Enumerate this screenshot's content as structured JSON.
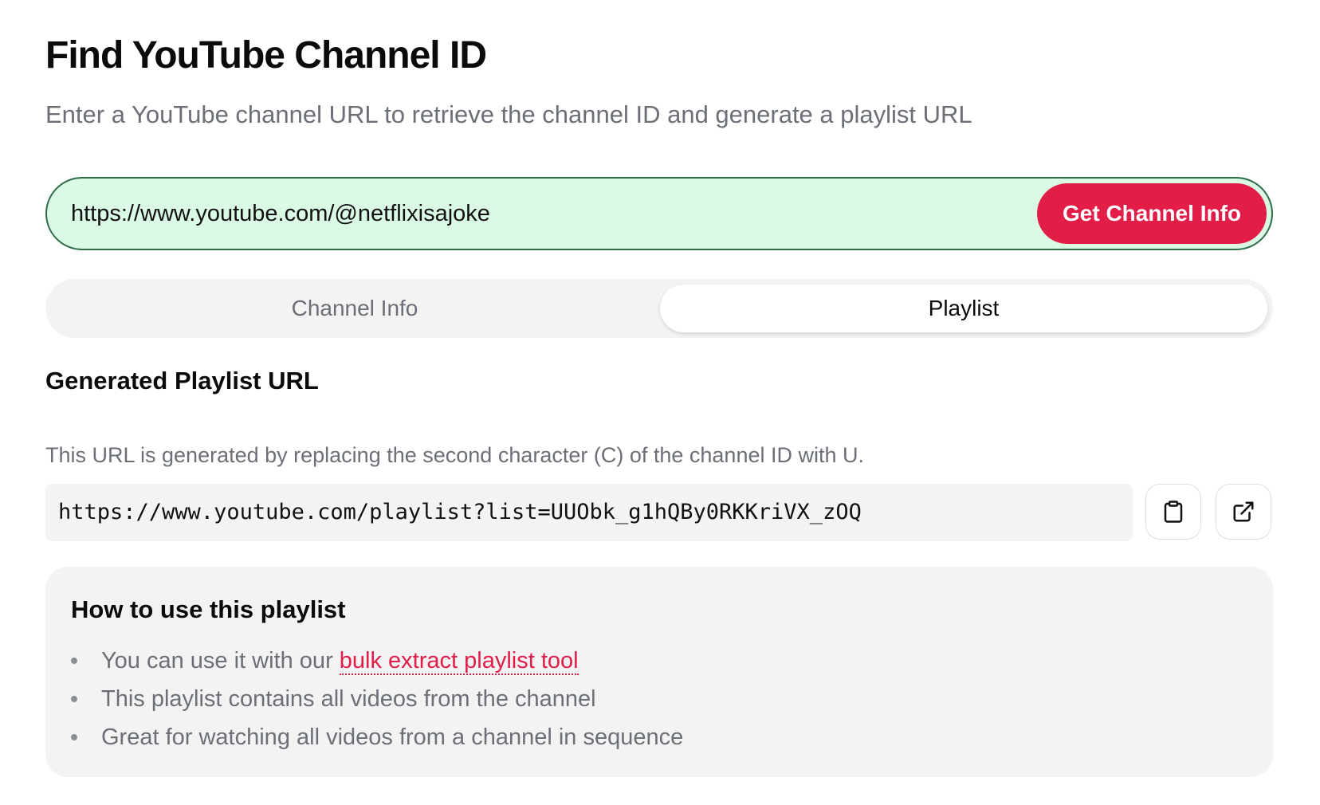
{
  "header": {
    "title": "Find YouTube Channel ID",
    "subtitle": "Enter a YouTube channel URL to retrieve the channel ID and generate a playlist URL"
  },
  "search": {
    "value": "https://www.youtube.com/@netflixisajoke",
    "button_label": "Get Channel Info",
    "button_color": "#e11d48",
    "input_background": "#dbfae6"
  },
  "tabs": [
    {
      "label": "Channel Info",
      "active": false
    },
    {
      "label": "Playlist",
      "active": true
    }
  ],
  "playlist": {
    "section_title": "Generated Playlist URL",
    "description": "This URL is generated by replacing the second character (C) of the channel ID with U.",
    "url": "https://www.youtube.com/playlist?list=UUObk_g1hQBy0RKKriVX_zOQ",
    "copy_icon": "clipboard-icon",
    "open_icon": "external-link-icon"
  },
  "howto": {
    "title": "How to use this playlist",
    "item1_prefix": "You can use it with our ",
    "item1_link": "bulk extract playlist tool",
    "item2": "This playlist contains all videos from the channel",
    "item3": "Great for watching all videos from a channel in sequence"
  }
}
